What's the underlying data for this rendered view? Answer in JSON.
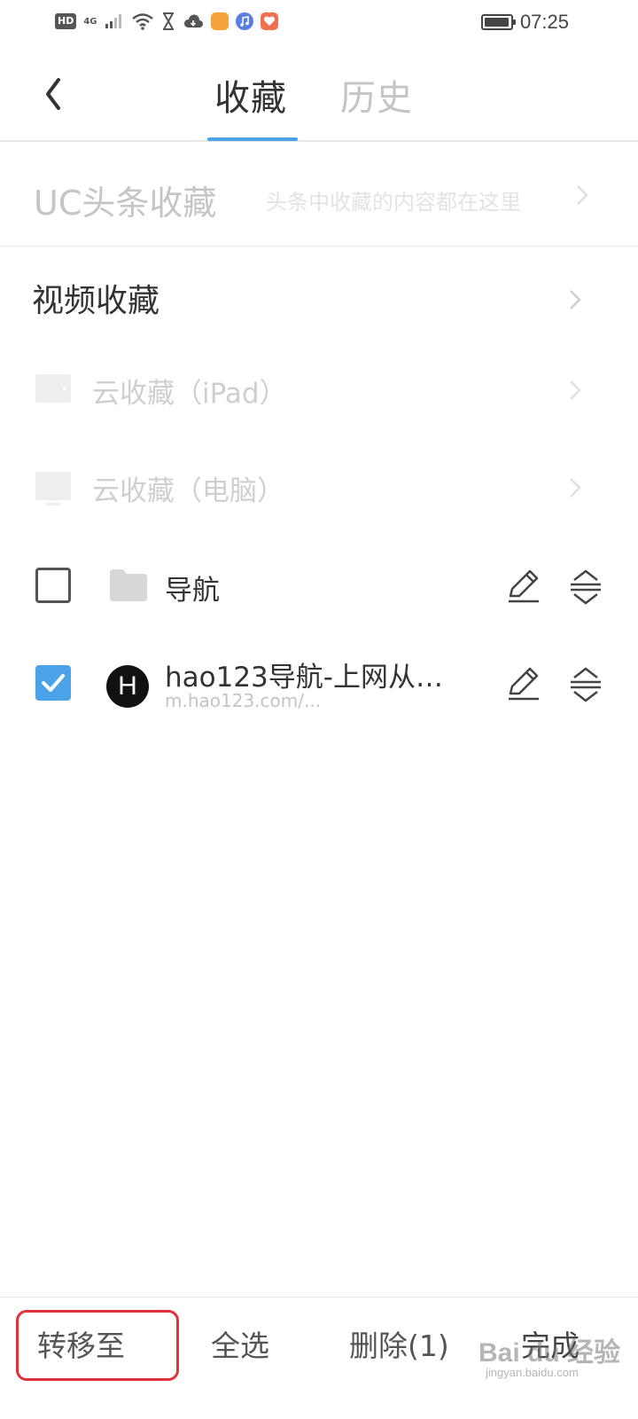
{
  "status_bar": {
    "network_badge": "HD",
    "network_type": "4G",
    "time": "07:25",
    "battery_level": 0.95,
    "icons": [
      "signal-icon",
      "wifi-icon",
      "hourglass-icon",
      "cloud-download-icon",
      "app-orange-icon",
      "music-icon",
      "health-icon",
      "battery-icon"
    ]
  },
  "header": {
    "back_icon": "chevron-left-icon",
    "tabs": [
      {
        "label": "收藏",
        "active": true
      },
      {
        "label": "历史",
        "active": false
      }
    ],
    "accent_color": "#4aa3e6"
  },
  "uc_favorites": {
    "title": "UC头条收藏",
    "description": "头条中收藏的内容都在这里"
  },
  "video_favorites": {
    "title": "视频收藏"
  },
  "cloud_favorites": [
    {
      "label": "云收藏（iPad）",
      "icon": "tablet-icon"
    },
    {
      "label": "云收藏（电脑）",
      "icon": "monitor-icon"
    }
  ],
  "items": [
    {
      "type": "folder",
      "title": "导航",
      "checked": false,
      "icon": "folder-icon"
    },
    {
      "type": "bookmark",
      "title": "hao123导航-上网从…",
      "url": "m.hao123.com/...",
      "avatar_letter": "H",
      "checked": true
    }
  ],
  "bottom_bar": {
    "move_label": "转移至",
    "select_all_label": "全选",
    "delete_label": "删除(1)",
    "done_label": "完成",
    "highlight_color": "#e0323a"
  },
  "watermark": {
    "text": "Bai du 经验",
    "sub": "jingyan.baidu.com"
  }
}
